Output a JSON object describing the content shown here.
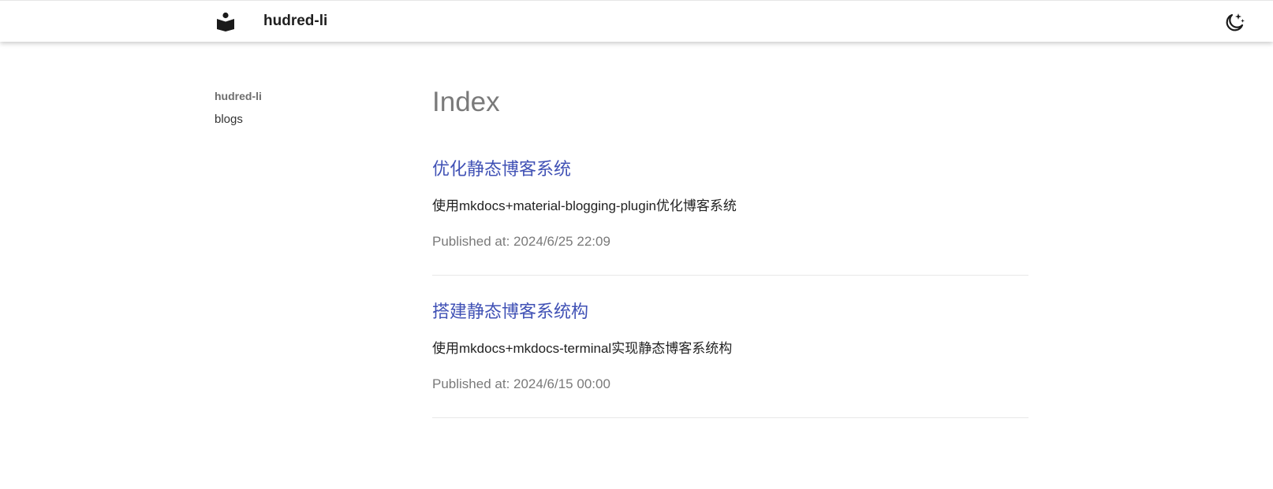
{
  "header": {
    "site_title": "hudred-li",
    "logo_icon": "reading-book-icon",
    "theme_toggle_icon": "moon-stars-icon"
  },
  "sidebar": {
    "title": "hudred-li",
    "items": [
      {
        "label": "blogs"
      }
    ]
  },
  "main": {
    "page_title": "Index",
    "posts": [
      {
        "title": "优化静态博客系统",
        "description": "使用mkdocs+material-blogging-plugin优化博客系统",
        "published": "Published at: 2024/6/25 22:09"
      },
      {
        "title": "搭建静态博客系统构",
        "description": "使用mkdocs+mkdocs-terminal实现静态博客系统构",
        "published": "Published at: 2024/6/15 00:00"
      }
    ]
  },
  "colors": {
    "link": "#4051b5",
    "muted_text": "#7a7a7a",
    "header_bg": "#ffffff"
  }
}
